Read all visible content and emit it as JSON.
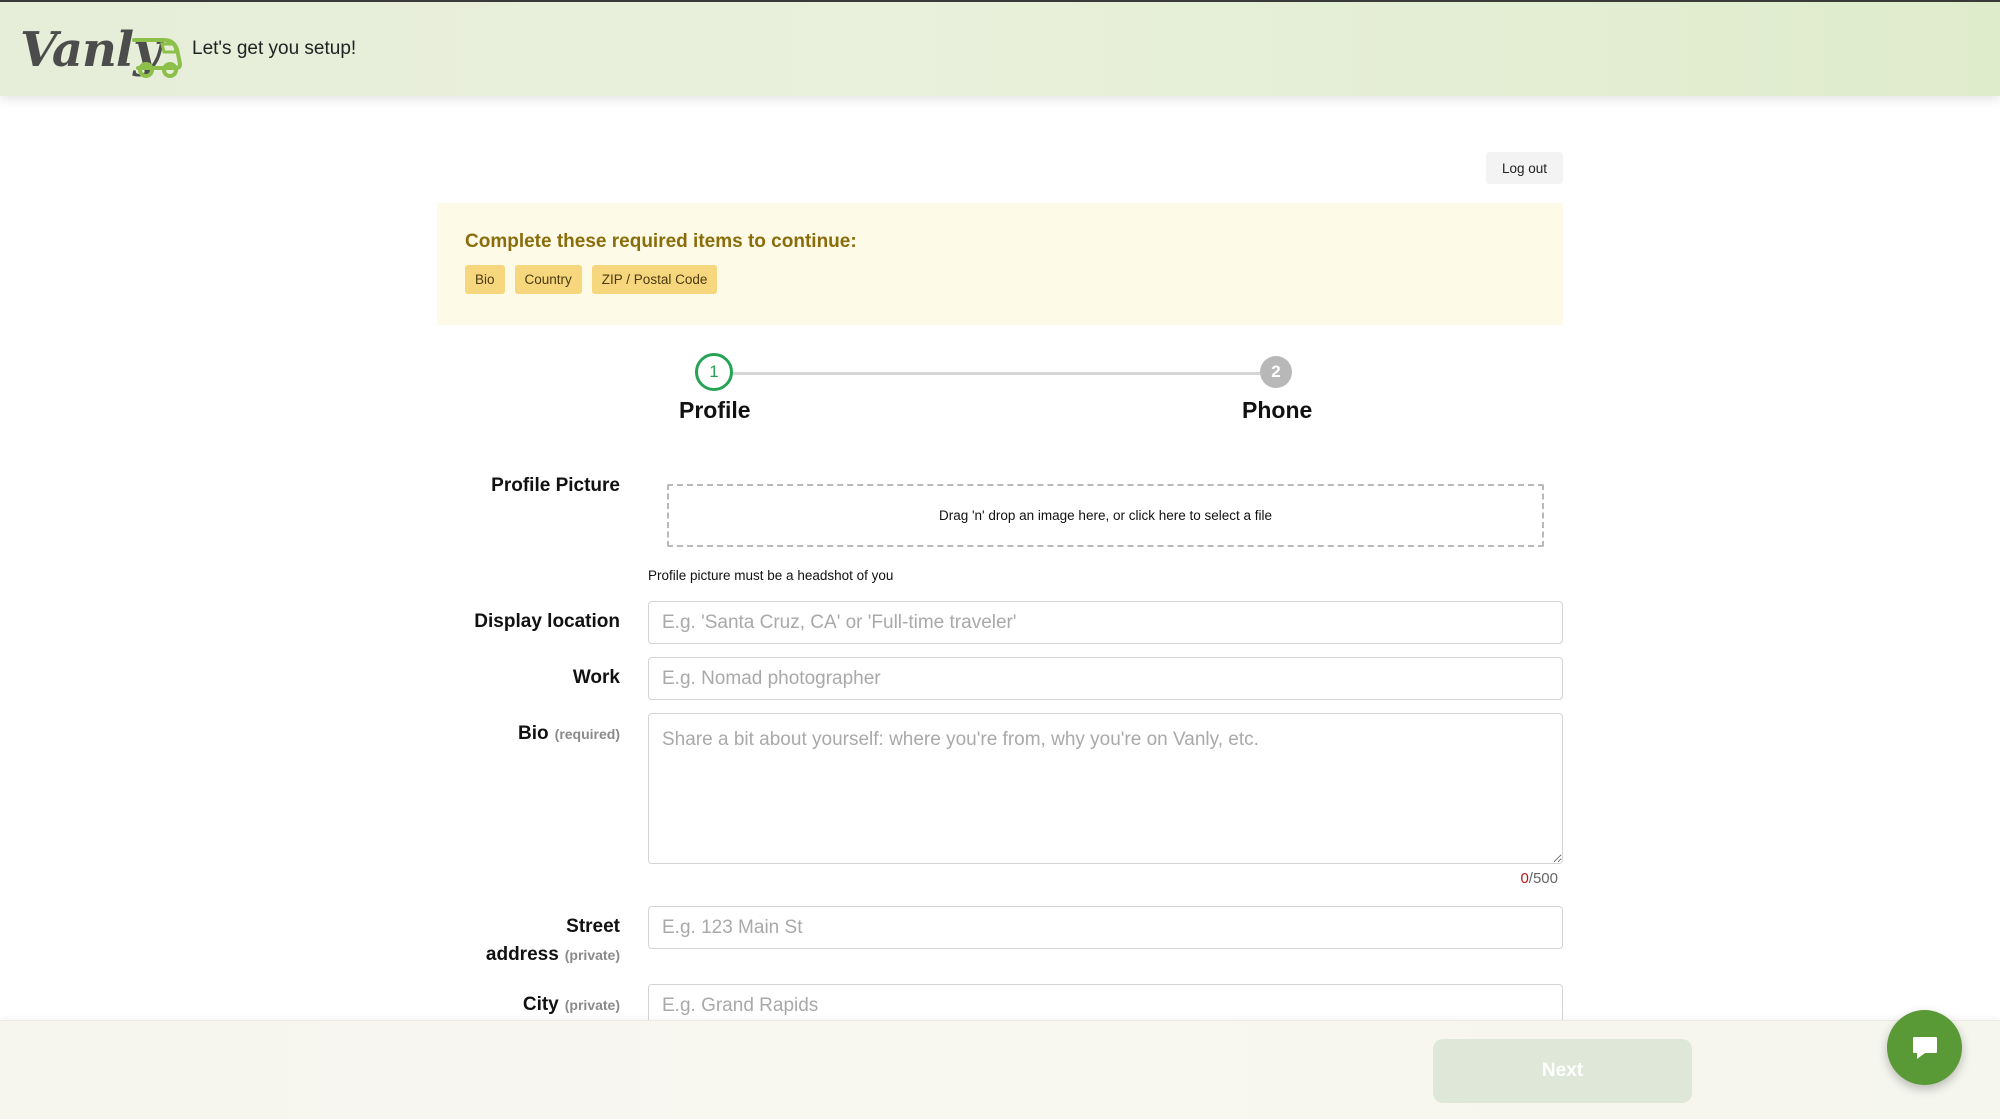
{
  "header": {
    "logo_text": "Vanly",
    "tagline": "Let's get you setup!"
  },
  "logout_label": "Log out",
  "required_banner": {
    "title": "Complete these required items to continue:",
    "chips": [
      "Bio",
      "Country",
      "ZIP / Postal Code"
    ]
  },
  "stepper": {
    "steps": [
      {
        "number": "1",
        "label": "Profile",
        "state": "active"
      },
      {
        "number": "2",
        "label": "Phone",
        "state": "pending"
      }
    ]
  },
  "form": {
    "profile_picture": {
      "label": "Profile Picture",
      "dropzone_text": "Drag 'n' drop an image here, or click here to select a file",
      "hint": "Profile picture must be a headshot of you"
    },
    "display_location": {
      "label": "Display location",
      "placeholder": "E.g. 'Santa Cruz, CA' or 'Full-time traveler'",
      "value": ""
    },
    "work": {
      "label": "Work",
      "placeholder": "E.g. Nomad photographer",
      "value": ""
    },
    "bio": {
      "label": "Bio",
      "sublabel": "(required)",
      "placeholder": "Share a bit about yourself: where you're from, why you're on Vanly, etc.",
      "value": "",
      "count": "0",
      "max": "/500"
    },
    "street_address": {
      "label_line1": "Street",
      "label_line2": "address",
      "sublabel": "(private)",
      "placeholder": "E.g. 123 Main St",
      "value": ""
    },
    "city": {
      "label": "City",
      "sublabel": "(private)",
      "placeholder": "E.g. Grand Rapids",
      "value": ""
    }
  },
  "footer": {
    "next_label": "Next"
  },
  "colors": {
    "accent_green": "#27a356",
    "chat_green": "#5a9a36",
    "chip_yellow": "#f7d77e",
    "banner_bg": "#fefae8",
    "banner_text": "#8a6d0b"
  },
  "icons": {
    "chat": "chat-bubble-icon",
    "logo_van": "van-icon"
  }
}
